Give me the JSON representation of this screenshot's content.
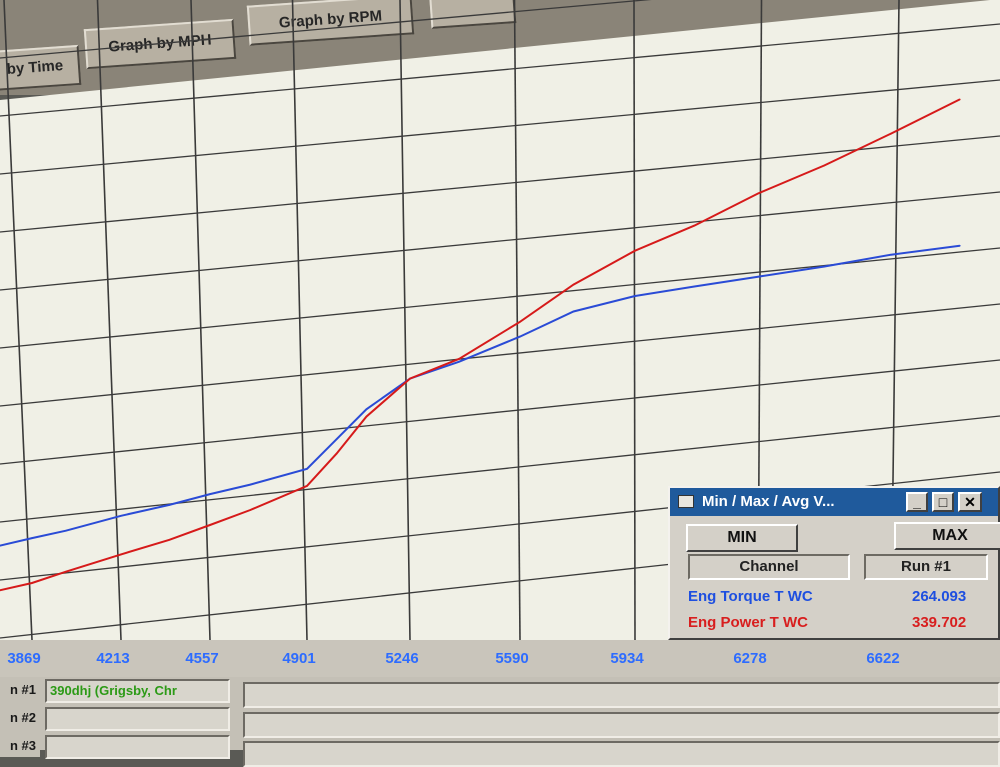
{
  "toolbar": {
    "buttons": [
      "by Time",
      "Graph by MPH",
      "Graph by RPM",
      ""
    ]
  },
  "chart_data": {
    "type": "line",
    "xlabel": "",
    "ylabel": "",
    "x_ticks": [
      3869,
      4213,
      4557,
      4901,
      5246,
      5590,
      5934,
      6278,
      6622
    ],
    "xlim": [
      3700,
      7000
    ],
    "ylim": [
      0,
      360
    ],
    "grid": true,
    "series": [
      {
        "name": "Eng Torque T WC",
        "color": "#2a4bd6",
        "x": [
          3700,
          3869,
          4000,
          4213,
          4400,
          4557,
          4700,
          4901,
          5000,
          5100,
          5246,
          5400,
          5590,
          5750,
          5934,
          6100,
          6278,
          6450,
          6622,
          6800
        ],
        "y": [
          68,
          75,
          80,
          90,
          97,
          104,
          110,
          120,
          140,
          160,
          180,
          190,
          205,
          220,
          228,
          232,
          236,
          240,
          245,
          248
        ]
      },
      {
        "name": "Eng Power T WC",
        "color": "#d61a1a",
        "x": [
          3700,
          3869,
          4000,
          4213,
          4400,
          4557,
          4700,
          4901,
          5000,
          5100,
          5246,
          5400,
          5590,
          5750,
          5934,
          6100,
          6278,
          6450,
          6622,
          6800
        ],
        "y": [
          35,
          42,
          50,
          62,
          72,
          82,
          92,
          108,
          130,
          155,
          180,
          192,
          215,
          238,
          258,
          272,
          290,
          305,
          322,
          340
        ]
      }
    ]
  },
  "x_axis": {
    "tick_labels": [
      "3869",
      "4213",
      "4557",
      "4901",
      "5246",
      "5590",
      "5934",
      "6278",
      "6622"
    ]
  },
  "runs": [
    {
      "label": "n #1",
      "name": "390dhj (Grigsby, Chr"
    },
    {
      "label": "n #2",
      "name": ""
    },
    {
      "label": "n #3",
      "name": ""
    }
  ],
  "minmax_window": {
    "title": "Min / Max / Avg V...",
    "min_button": "MIN",
    "max_button": "MAX",
    "col_channel": "Channel",
    "col_run": "Run #1",
    "rows": [
      {
        "channel": "Eng Torque T WC",
        "value": "264.093",
        "color": "#1e4fe0"
      },
      {
        "channel": "Eng Power T WC",
        "value": "339.702",
        "color": "#d81e1e"
      }
    ]
  }
}
